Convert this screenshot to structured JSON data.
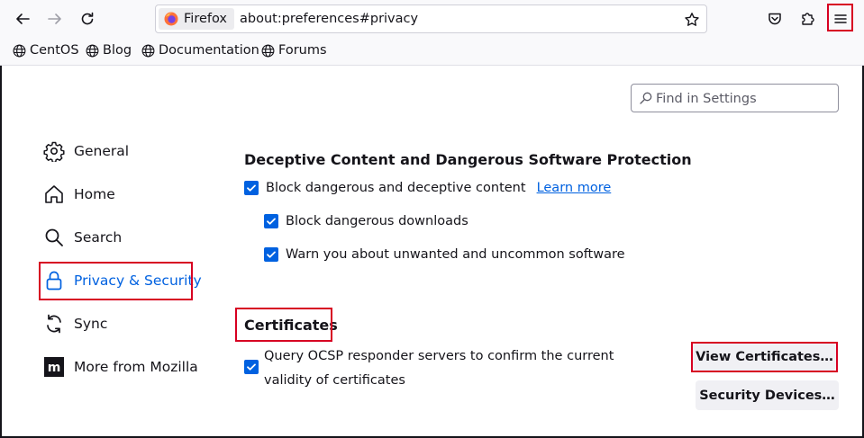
{
  "colors": {
    "accent": "#0061e0",
    "highlight": "#d70022",
    "toolbar_bg": "#f9f9fb"
  },
  "toolbar": {
    "back_icon": "arrow-left-icon",
    "forward_icon": "arrow-right-icon",
    "reload_icon": "reload-icon",
    "identity_label": "Firefox",
    "url": "about:preferences#privacy",
    "star_icon": "star-icon",
    "pocket_icon": "pocket-icon",
    "extensions_icon": "puzzle-icon",
    "menu_icon": "hamburger-menu-icon"
  },
  "bookmarks": [
    {
      "label": "CentOS"
    },
    {
      "label": "Blog"
    },
    {
      "label": "Documentation"
    },
    {
      "label": "Forums"
    }
  ],
  "search": {
    "placeholder": "Find in Settings"
  },
  "categories": [
    {
      "label": "General",
      "icon": "gear-icon"
    },
    {
      "label": "Home",
      "icon": "home-icon"
    },
    {
      "label": "Search",
      "icon": "search-icon"
    },
    {
      "label": "Privacy & Security",
      "icon": "lock-icon",
      "selected": true
    },
    {
      "label": "Sync",
      "icon": "sync-icon"
    },
    {
      "label": "More from Mozilla",
      "icon": "mozilla-icon"
    }
  ],
  "deceptive": {
    "heading": "Deceptive Content and Dangerous Software Protection",
    "block_label": "Block dangerous and deceptive content",
    "learn_more": "Learn more",
    "downloads_label": "Block dangerous downloads",
    "unwanted_label": "Warn you about unwanted and uncommon software"
  },
  "certificates": {
    "heading": "Certificates",
    "ocsp_label": "Query OCSP responder servers to confirm the current validity of certificates",
    "view_button": "View Certificates…",
    "devices_button": "Security Devices…"
  }
}
